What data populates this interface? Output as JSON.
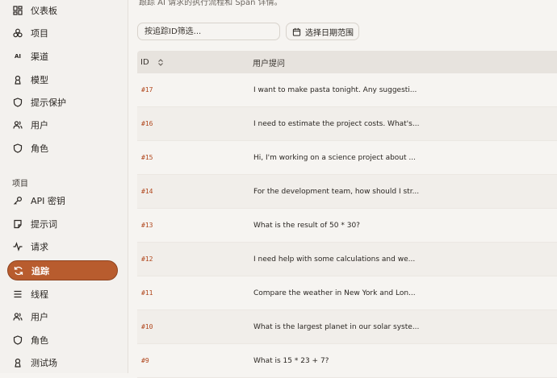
{
  "sidebar": {
    "items_top": [
      {
        "label": "仪表板",
        "icon": "dashboard-icon"
      },
      {
        "label": "项目",
        "icon": "projects-icon"
      },
      {
        "label": "渠道",
        "icon": "ai-channel-icon"
      },
      {
        "label": "模型",
        "icon": "model-icon"
      },
      {
        "label": "提示保护",
        "icon": "shield-icon"
      },
      {
        "label": "用户",
        "icon": "users-icon"
      },
      {
        "label": "角色",
        "icon": "role-shield-icon"
      }
    ],
    "section_label": "项目",
    "items_project": [
      {
        "label": "API 密钥",
        "icon": "key-icon"
      },
      {
        "label": "提示词",
        "icon": "prompt-icon"
      },
      {
        "label": "请求",
        "icon": "activity-icon"
      },
      {
        "label": "追踪",
        "icon": "trace-icon",
        "active": true
      },
      {
        "label": "线程",
        "icon": "list-icon"
      },
      {
        "label": "用户",
        "icon": "users-icon"
      },
      {
        "label": "角色",
        "icon": "role-shield-icon"
      },
      {
        "label": "测试场",
        "icon": "playground-icon"
      }
    ],
    "ai_badge": "AI",
    "active_color": "#b85c2e"
  },
  "main": {
    "top_text": "跟踪 AI 请求的执行流程和 Span 详情。",
    "filter_placeholder": "按追踪ID筛选...",
    "date_button_label": "选择日期范围",
    "table": {
      "columns": [
        "ID",
        "用户提问"
      ],
      "rows": [
        {
          "id": "#17",
          "question": "I want to make pasta tonight. Any suggesti..."
        },
        {
          "id": "#16",
          "question": "I need to estimate the project costs. What's..."
        },
        {
          "id": "#15",
          "question": "Hi, I'm working on a science project about ..."
        },
        {
          "id": "#14",
          "question": "For the development team, how should I str..."
        },
        {
          "id": "#13",
          "question": "What is the result of 50 * 30?"
        },
        {
          "id": "#12",
          "question": "I need help with some calculations and we..."
        },
        {
          "id": "#11",
          "question": "Compare the weather in New York and Lon..."
        },
        {
          "id": "#10",
          "question": "What is the largest planet in our solar syste..."
        },
        {
          "id": "#9",
          "question": "What is 15 * 23 + 7?"
        }
      ]
    }
  }
}
